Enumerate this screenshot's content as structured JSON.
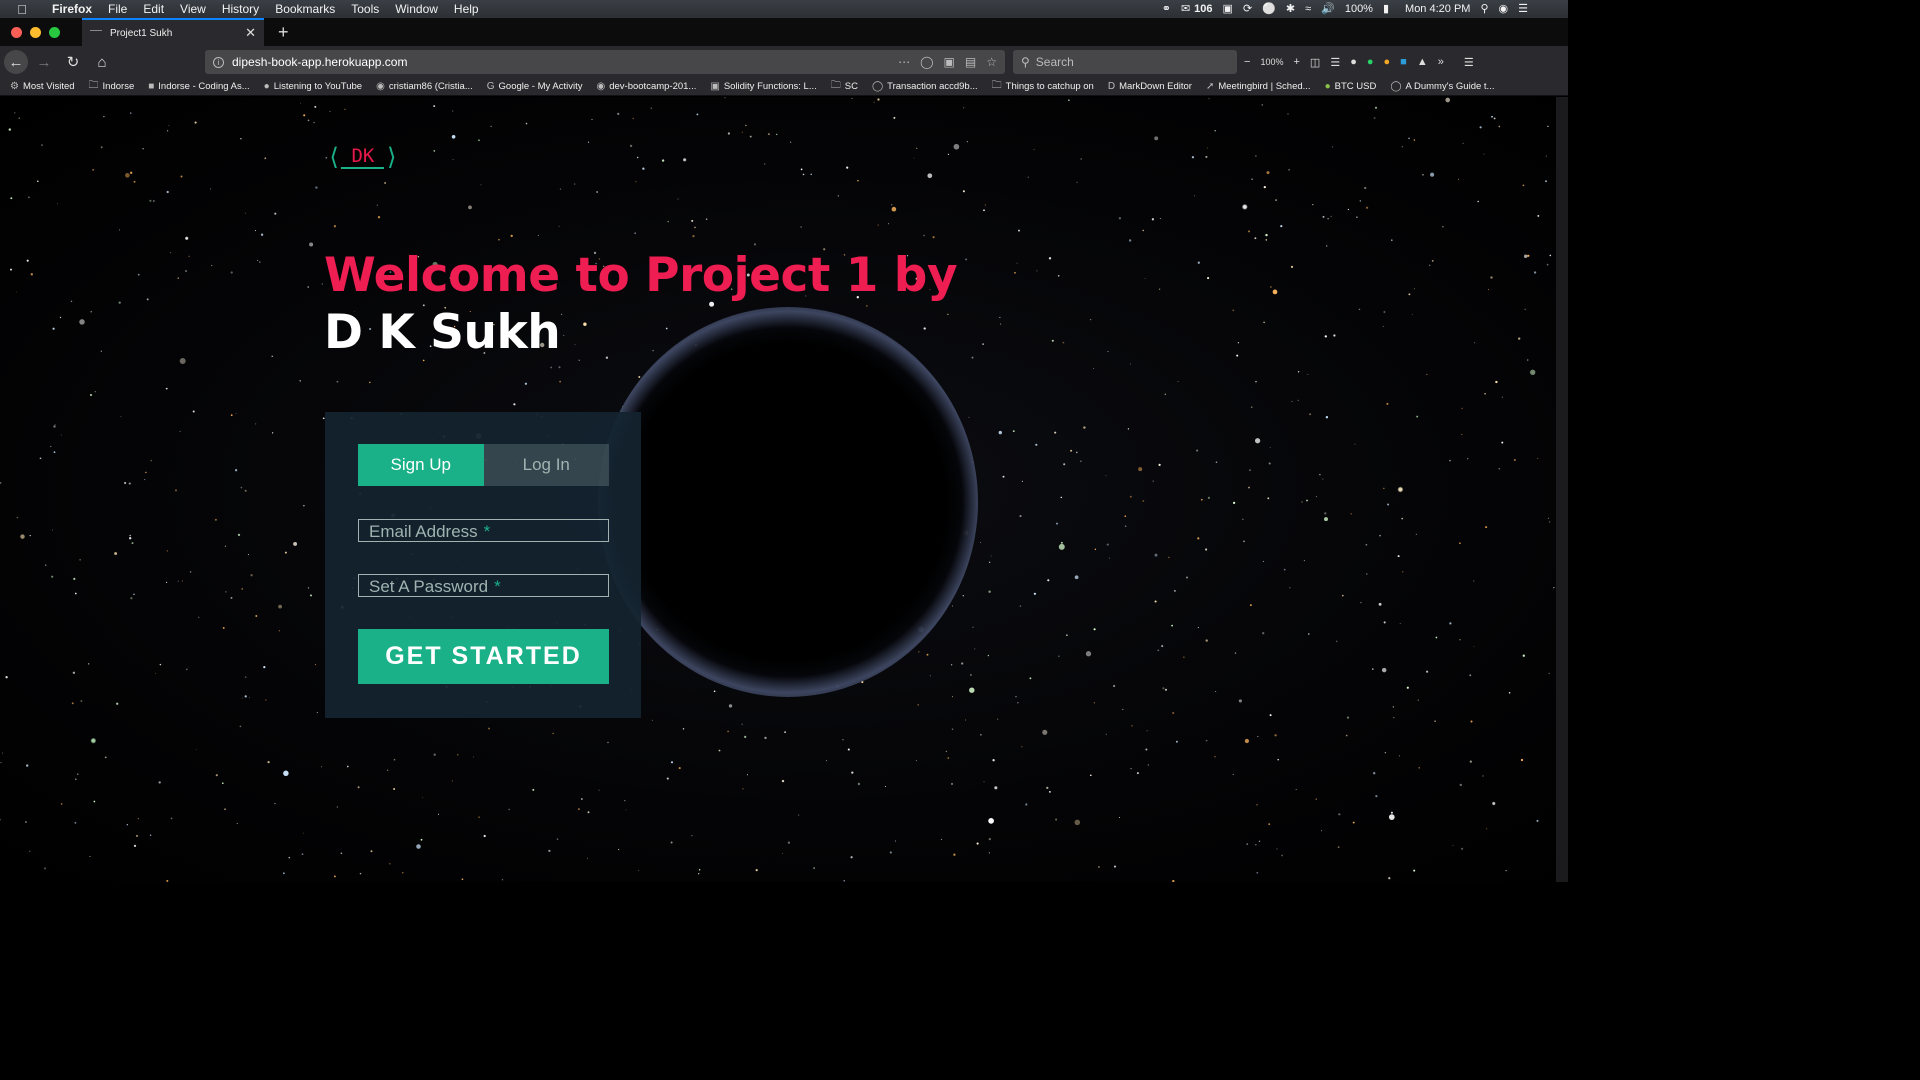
{
  "menubar": {
    "app": "Firefox",
    "items": [
      "File",
      "Edit",
      "View",
      "History",
      "Bookmarks",
      "Tools",
      "Window",
      "Help"
    ],
    "mail_count": "106",
    "battery": "100%",
    "clock": "Mon 4:20 PM"
  },
  "tab": {
    "title": "Project1 Sukh"
  },
  "toolbar": {
    "url": "dipesh-book-app.herokuapp.com",
    "search_placeholder": "Search",
    "zoom": "100%"
  },
  "bookmarks": [
    "Most Visited",
    "Indorse",
    "Indorse - Coding As...",
    "Listening to YouTube",
    "cristiam86 (Cristia...",
    "Google - My Activity",
    "dev-bootcamp-201...",
    "Solidity Functions: L...",
    "SC",
    "Transaction accd9b...",
    "Things to catchup on",
    "MarkDown Editor",
    "Meetingbird | Sched...",
    "BTC USD",
    "A Dummy's Guide t..."
  ],
  "page": {
    "logo_text": "DK",
    "heading_line1": "Welcome to Project 1 by",
    "heading_line2": "D K Sukh",
    "tab_signup": "Sign Up",
    "tab_login": "Log In",
    "email_label": "Email Address",
    "password_label": "Set A Password",
    "required_marker": "*",
    "cta_label": "GET STARTED"
  },
  "colors": {
    "accent": "#1ab188",
    "heading_red": "#ee1e53",
    "form_bg": "#13232f"
  }
}
